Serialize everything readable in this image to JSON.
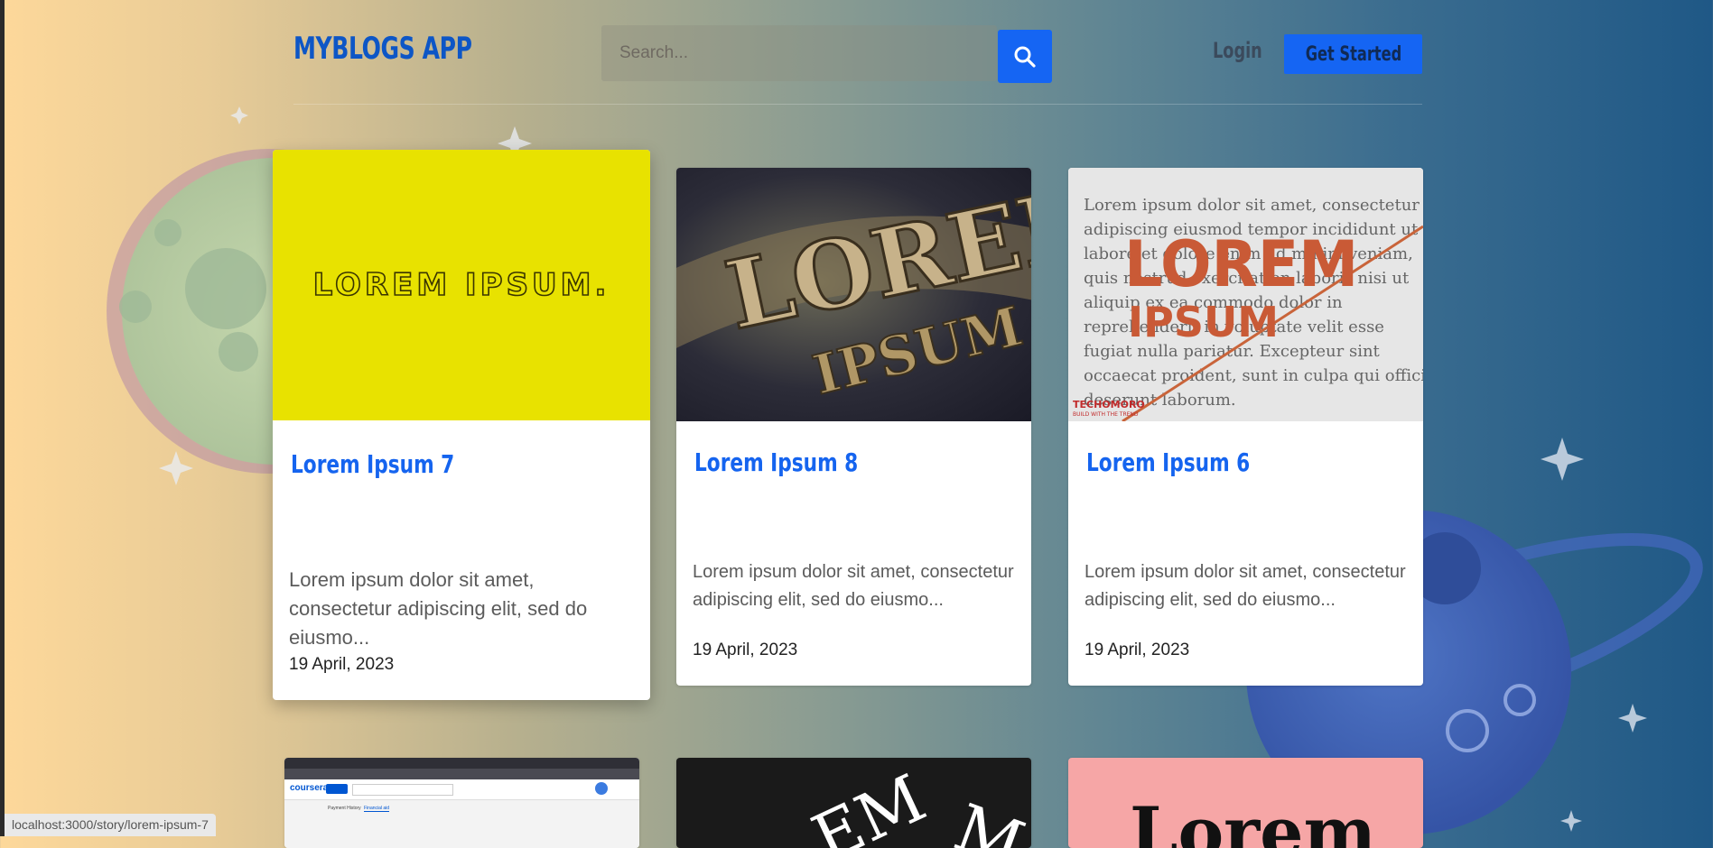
{
  "header": {
    "logo": "MYBLOGS APP",
    "search_placeholder": "Search...",
    "login_label": "Login",
    "get_started_label": "Get Started"
  },
  "cards": [
    {
      "title": "Lorem Ipsum 7",
      "image_text": "LOREM IPSUM.",
      "excerpt": "Lorem ipsum dolor sit amet, consectetur adipiscing elit, sed do eiusmo...",
      "date": "19 April, 2023",
      "image_bg": "#e8e200"
    },
    {
      "title": "Lorem Ipsum 8",
      "image_text_1": "LOREM",
      "image_text_2": "IPSUM",
      "excerpt": "Lorem ipsum dolor sit amet, consectetur adipiscing elit, sed do eiusmo...",
      "date": "19 April, 2023"
    },
    {
      "title": "Lorem Ipsum 6",
      "image_text_1": "LOREM",
      "image_text_2": "IPSUM",
      "image_brand": "TECHOMORO",
      "image_tagline": "BUILD WITH THE TREND",
      "excerpt": "Lorem ipsum dolor sit amet, consectetur adipiscing elit, sed do eiusmo...",
      "date": "19 April, 2023",
      "image_body": "Lorem ipsum dolor sit amet, consectetur adipiscing eiusmod tempor incididunt ut labore et dolore enim ad minim veniam, quis nostrud exercitation laboris nisi ut aliquip ex ea commodo dolor in reprehenderit in voluptate velit esse fugiat nulla pariatur. Excepteur sint occaecat proident, sunt in culpa qui officia deserunt laborum."
    }
  ],
  "second_row": {
    "card4_brand": "coursera",
    "card4_tab1": "Payment History",
    "card4_tab2": "Financial aid",
    "card5_text": "EM",
    "card6_text": "Lorem"
  },
  "status_url": "localhost:3000/story/lorem-ipsum-7",
  "colors": {
    "accent": "#1565f3",
    "title": "#1564ef",
    "card7_bg": "#e8e200"
  }
}
